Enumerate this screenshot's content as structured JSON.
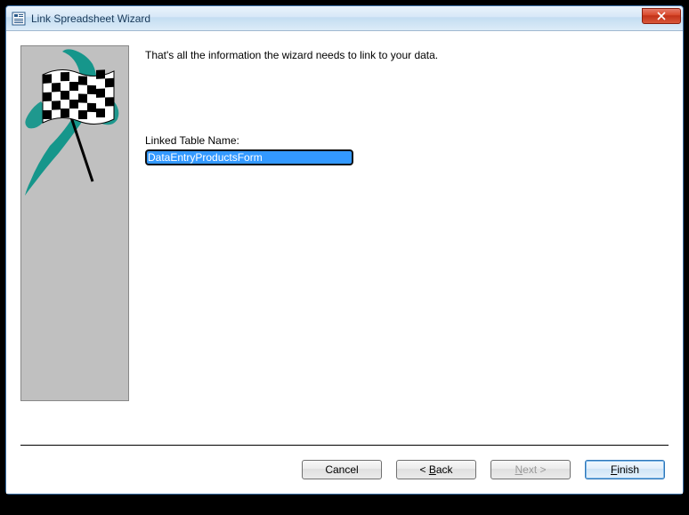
{
  "window": {
    "title": "Link Spreadsheet Wizard"
  },
  "wizard": {
    "info_text": "That's all the information the wizard needs to link to your data.",
    "field_label": "Linked Table Name:",
    "field_value": "DataEntryProductsForm"
  },
  "buttons": {
    "cancel": "Cancel",
    "back_prefix": "< ",
    "back_u": "B",
    "back_rest": "ack",
    "next_u": "N",
    "next_rest": "ext >",
    "finish_u": "F",
    "finish_rest": "inish"
  }
}
